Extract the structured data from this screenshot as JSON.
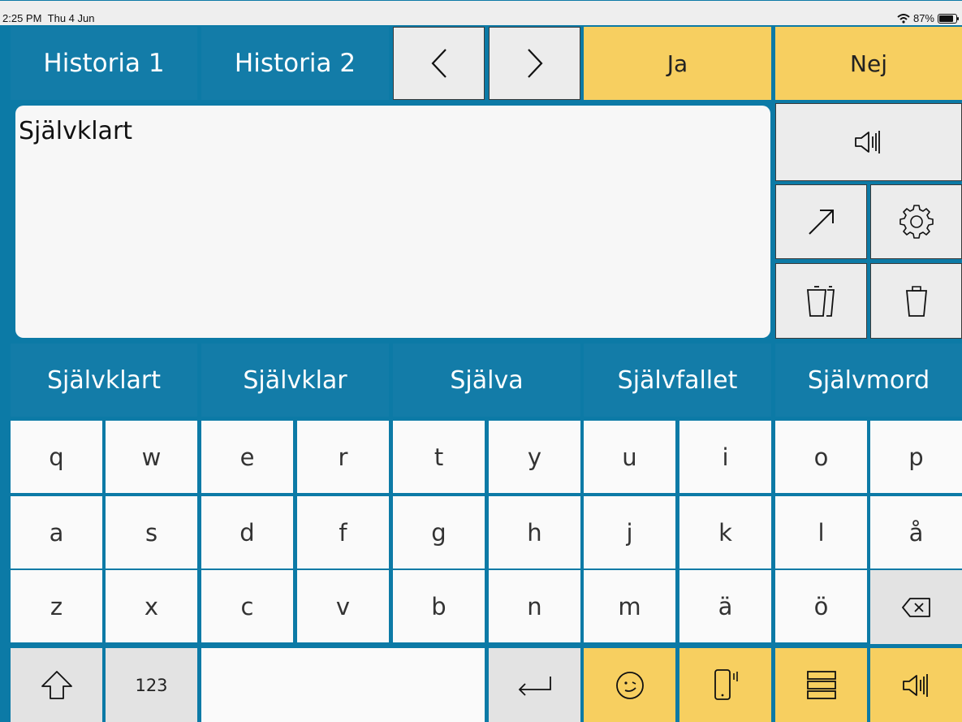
{
  "status_bar": {
    "time": "2:25 PM",
    "date": "Thu 4 Jun",
    "battery": "87%",
    "battery_level": 0.87
  },
  "top_row": {
    "history1": "Historia 1",
    "history2": "Historia 2",
    "yes": "Ja",
    "no": "Nej"
  },
  "text_area": {
    "value": "Självklart"
  },
  "suggestions": [
    "Självklart",
    "Självklar",
    "Själva",
    "Självfallet",
    "Självmord"
  ],
  "keyboard": {
    "row1": [
      "q",
      "w",
      "e",
      "r",
      "t",
      "y",
      "u",
      "i",
      "o",
      "p"
    ],
    "row2": [
      "a",
      "s",
      "d",
      "f",
      "g",
      "h",
      "j",
      "k",
      "l",
      "å"
    ],
    "row3": [
      "z",
      "x",
      "c",
      "v",
      "b",
      "n",
      "m",
      "ä",
      "ö"
    ],
    "numbers_label": "123"
  },
  "icons": {
    "prev": "chevron-left-icon",
    "next": "chevron-right-icon",
    "speak": "speaker-icon",
    "share": "arrow-up-right-icon",
    "settings": "gear-icon",
    "clear_all": "double-trash-icon",
    "clear": "trash-icon",
    "backspace": "backspace-icon",
    "shift": "shift-arrow-icon",
    "enter": "return-icon",
    "emoji": "smiley-icon",
    "device": "phone-vibrate-icon",
    "menu": "menu-bars-icon"
  },
  "colors": {
    "frame": "#0c7aa6",
    "blue_button": "#137ca8",
    "yellow_button": "#f7cf60",
    "key_bg": "#fafafa",
    "key_gray": "#e3e3e3"
  }
}
